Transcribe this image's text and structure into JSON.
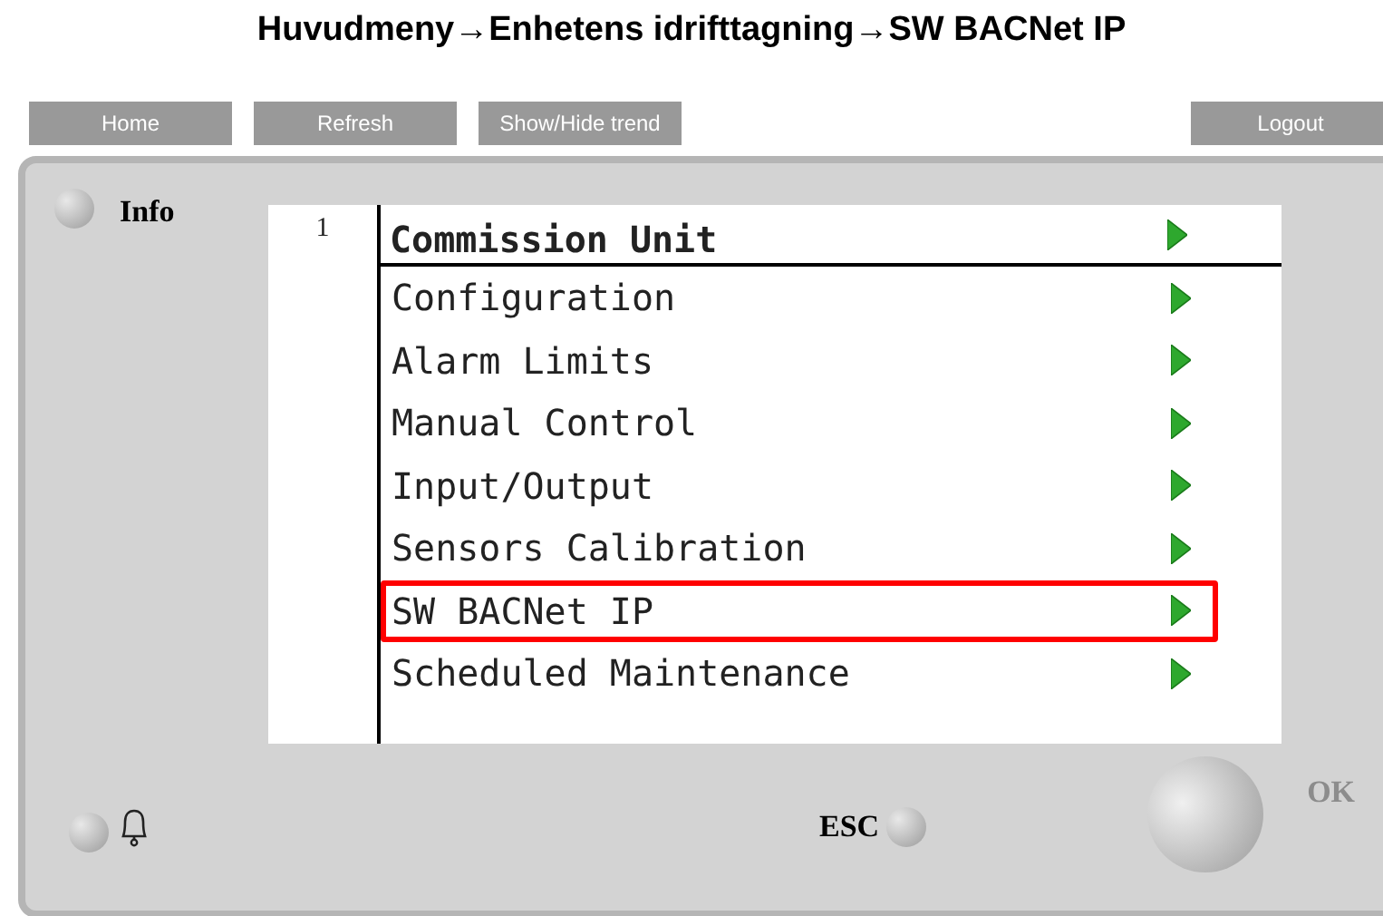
{
  "page_title": "Huvudmeny→Enhetens idrifttagning→SW BACNet IP",
  "toolbar": {
    "buttons": [
      "Home",
      "Refresh",
      "Show/Hide trend"
    ],
    "logout": "Logout"
  },
  "panel": {
    "info_label": "Info",
    "screen": {
      "line_number": "1",
      "header": "Commission Unit",
      "items": [
        {
          "label": "Configuration",
          "selected": false
        },
        {
          "label": "Alarm Limits",
          "selected": false
        },
        {
          "label": "Manual Control",
          "selected": false
        },
        {
          "label": "Input/Output",
          "selected": false
        },
        {
          "label": "Sensors Calibration",
          "selected": false
        },
        {
          "label": "SW BACNet IP",
          "selected": true
        },
        {
          "label": "Scheduled Maintenance",
          "selected": false
        }
      ]
    },
    "esc_label": "ESC",
    "ok_label": "OK"
  }
}
